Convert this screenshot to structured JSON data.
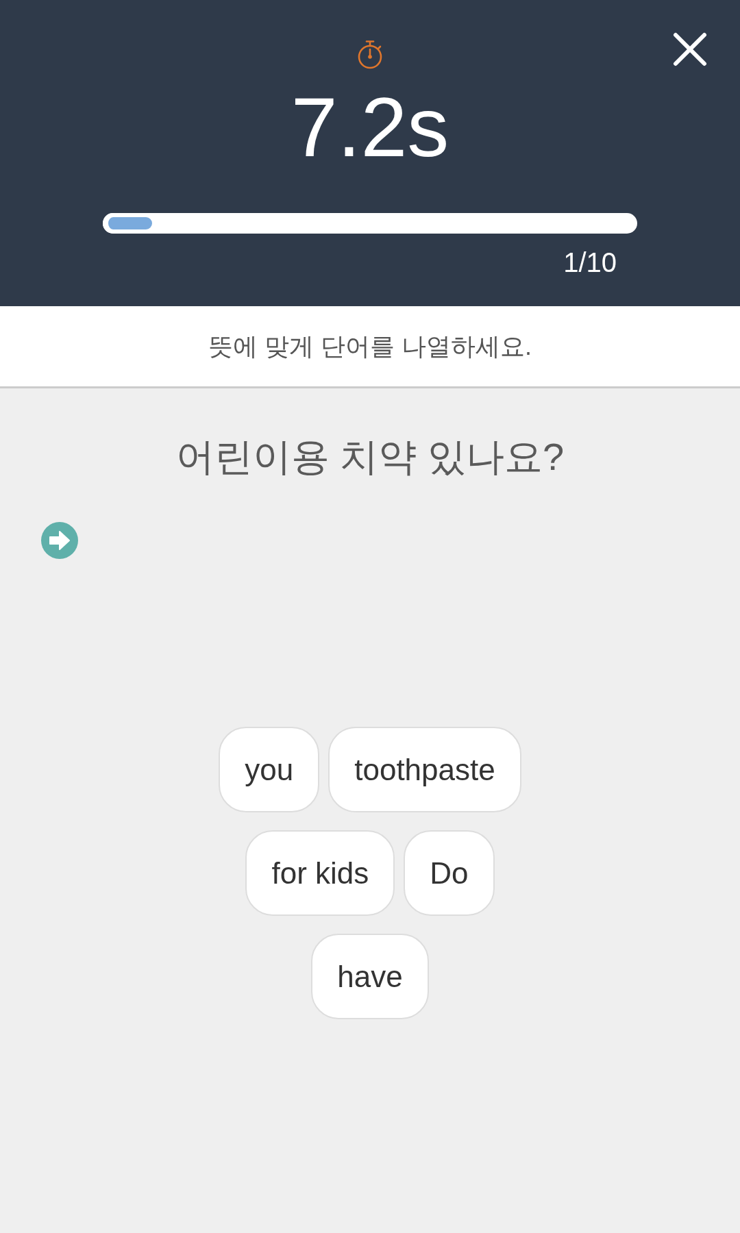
{
  "header": {
    "timer": "7.2s",
    "progress": {
      "level": 0.1
    },
    "counter": "1/10"
  },
  "instruction": "뜻에 맞게 단어를 나열하세요.",
  "question": "어린이용 치약 있나요?",
  "word_choices": [
    "you",
    "toothpaste",
    "for kids",
    "Do",
    "have"
  ]
}
